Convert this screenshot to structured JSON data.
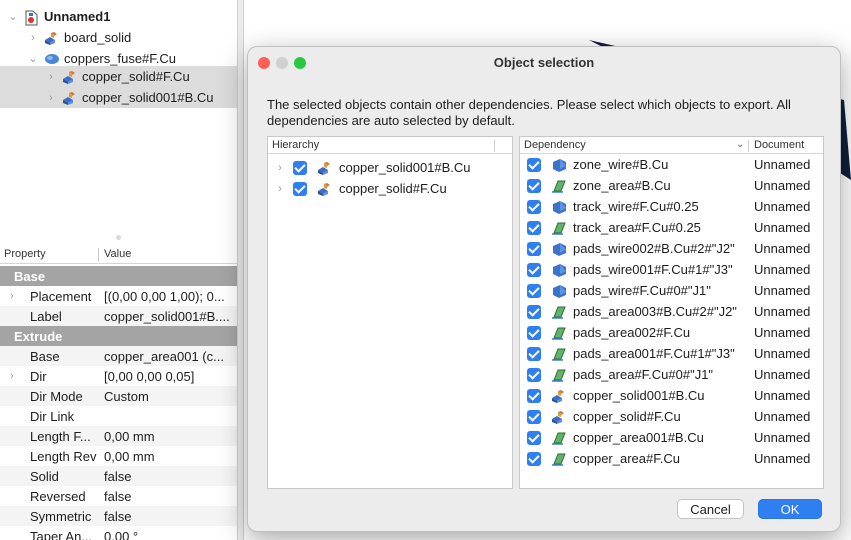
{
  "colors": {
    "accent": "#2f7ff2",
    "group_header": "#a4a4a4",
    "selection": "#dcdcdc"
  },
  "tree": {
    "items": [
      {
        "label": "Unnamed1",
        "icon": "document-icon",
        "bold": true,
        "chevron": "⌄"
      },
      {
        "label": "board_solid",
        "icon": "solid-icon",
        "bold": false,
        "chevron": "›"
      },
      {
        "label": "coppers_fuse#F.Cu",
        "icon": "fusion-icon",
        "bold": false,
        "chevron": "⌄"
      },
      {
        "label": "copper_solid#F.Cu",
        "icon": "solid-icon",
        "bold": false,
        "chevron": "›"
      },
      {
        "label": "copper_solid001#B.Cu",
        "icon": "solid-icon",
        "bold": false,
        "chevron": "›"
      }
    ]
  },
  "properties": {
    "header": {
      "property": "Property",
      "value": "Value"
    },
    "rows": [
      {
        "type": "group",
        "name": "Base"
      },
      {
        "type": "prop",
        "name": "Placement",
        "value": "[(0,00 0,00 1,00); 0...",
        "expandable": true
      },
      {
        "type": "prop",
        "name": "Label",
        "value": "copper_solid001#B...."
      },
      {
        "type": "group",
        "name": "Extrude"
      },
      {
        "type": "prop",
        "name": "Base",
        "value": "copper_area001 (c..."
      },
      {
        "type": "prop",
        "name": "Dir",
        "value": "[0,00 0,00 0,05]",
        "expandable": true
      },
      {
        "type": "prop",
        "name": "Dir Mode",
        "value": "Custom"
      },
      {
        "type": "prop",
        "name": "Dir Link",
        "value": ""
      },
      {
        "type": "prop",
        "name": "Length F...",
        "value": "0,00 mm"
      },
      {
        "type": "prop",
        "name": "Length Rev",
        "value": "0,00 mm"
      },
      {
        "type": "prop",
        "name": "Solid",
        "value": "false"
      },
      {
        "type": "prop",
        "name": "Reversed",
        "value": "false"
      },
      {
        "type": "prop",
        "name": "Symmetric",
        "value": "false"
      },
      {
        "type": "prop",
        "name": "Taper An...",
        "value": "0,00 °"
      }
    ]
  },
  "dialog": {
    "title": "Object selection",
    "message": "The selected objects contain other dependencies. Please select which objects to export. All dependencies are auto selected by default.",
    "hierarchy": {
      "header": "Hierarchy",
      "items": [
        {
          "label": "copper_solid001#B.Cu",
          "checked": true
        },
        {
          "label": "copper_solid#F.Cu",
          "checked": true
        }
      ]
    },
    "dependency": {
      "header_dependency": "Dependency",
      "header_document": "Document",
      "items": [
        {
          "name": "zone_wire#B.Cu",
          "icon": "wire-icon",
          "document": "Unnamed"
        },
        {
          "name": "zone_area#B.Cu",
          "icon": "face-icon",
          "document": "Unnamed"
        },
        {
          "name": "track_wire#F.Cu#0.25",
          "icon": "wire-icon",
          "document": "Unnamed"
        },
        {
          "name": "track_area#F.Cu#0.25",
          "icon": "face-icon",
          "document": "Unnamed"
        },
        {
          "name": "pads_wire002#B.Cu#2#\"J2\"",
          "icon": "wire-icon",
          "document": "Unnamed"
        },
        {
          "name": "pads_wire001#F.Cu#1#\"J3\"",
          "icon": "wire-icon",
          "document": "Unnamed"
        },
        {
          "name": "pads_wire#F.Cu#0#\"J1\"",
          "icon": "wire-icon",
          "document": "Unnamed"
        },
        {
          "name": "pads_area003#B.Cu#2#\"J2\"",
          "icon": "face-icon",
          "document": "Unnamed"
        },
        {
          "name": "pads_area002#F.Cu",
          "icon": "face-icon",
          "document": "Unnamed"
        },
        {
          "name": "pads_area001#F.Cu#1#\"J3\"",
          "icon": "face-icon",
          "document": "Unnamed"
        },
        {
          "name": "pads_area#F.Cu#0#\"J1\"",
          "icon": "face-icon",
          "document": "Unnamed"
        },
        {
          "name": "copper_solid001#B.Cu",
          "icon": "solid-icon",
          "document": "Unnamed"
        },
        {
          "name": "copper_solid#F.Cu",
          "icon": "solid-icon",
          "document": "Unnamed"
        },
        {
          "name": "copper_area001#B.Cu",
          "icon": "face-icon",
          "document": "Unnamed"
        },
        {
          "name": "copper_area#F.Cu",
          "icon": "face-icon",
          "document": "Unnamed"
        }
      ]
    },
    "buttons": {
      "cancel": "Cancel",
      "ok": "OK"
    }
  }
}
